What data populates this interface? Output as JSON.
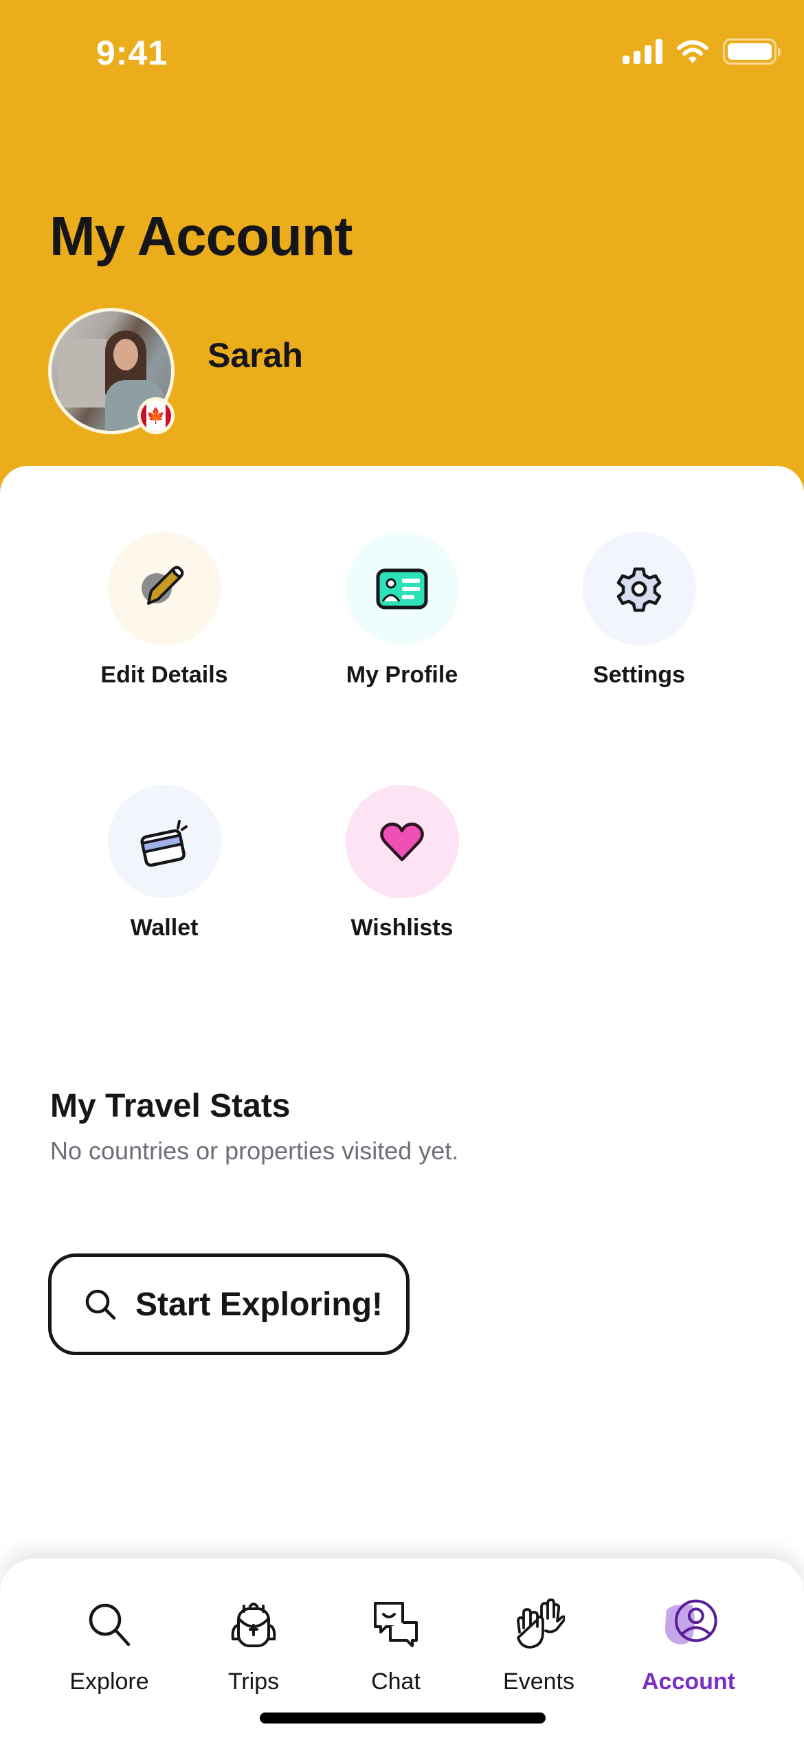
{
  "status_bar": {
    "time": "9:41"
  },
  "header": {
    "title": "My Account",
    "user_name": "Sarah",
    "flag": "canada-flag",
    "background_color": "#EBAD1C"
  },
  "menu": {
    "items": [
      {
        "label": "Edit Details",
        "icon": "pencil-icon",
        "bg": "#FEF8EC"
      },
      {
        "label": "My Profile",
        "icon": "id-card-icon",
        "bg": "#EFFEFD"
      },
      {
        "label": "Settings",
        "icon": "gear-icon",
        "bg": "#F3F5FC"
      },
      {
        "label": "Wallet",
        "icon": "credit-card-icon",
        "bg": "#F3F5FC"
      },
      {
        "label": "Wishlists",
        "icon": "heart-icon",
        "bg": "#FCE4F4"
      }
    ]
  },
  "travel_stats": {
    "title": "My Travel Stats",
    "subtitle": "No countries or properties visited yet."
  },
  "cta": {
    "label": "Start Exploring!",
    "icon": "search-icon"
  },
  "bottom_nav": {
    "active_color": "#7A2FC4",
    "items": [
      {
        "label": "Explore",
        "icon": "search-icon",
        "active": false
      },
      {
        "label": "Trips",
        "icon": "backpack-icon",
        "active": false
      },
      {
        "label": "Chat",
        "icon": "chat-bubbles-icon",
        "active": false
      },
      {
        "label": "Events",
        "icon": "waving-hands-icon",
        "active": false
      },
      {
        "label": "Account",
        "icon": "user-circle-icon",
        "active": true
      }
    ]
  }
}
